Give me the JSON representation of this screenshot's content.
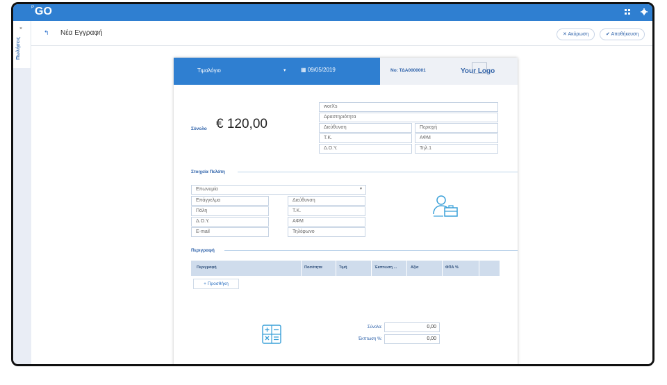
{
  "app": {
    "brand_prefix": "P",
    "brand": "GO"
  },
  "sidebar": {
    "close": "×",
    "label": "Πωλήσεις"
  },
  "header": {
    "back_icon": "↰",
    "title": "Νέα Εγγραφή",
    "cancel": "Ακύρωση",
    "save": "Αποθήκευση"
  },
  "doc": {
    "type": "Τιμολόγιο",
    "date": "09/05/2019",
    "number": "No: ΤΔΑ0000001",
    "logo": "Your Logo",
    "total_label": "Σύνολο",
    "total": "€ 120,00",
    "company": {
      "name": "worXs",
      "activity": "Δραστηριότητα",
      "address": "Διεύθυνση",
      "area": "Περιοχή",
      "zip": "Τ.Κ.",
      "afm": "ΑΦΜ",
      "doy": "Δ.Ο.Υ.",
      "phone": "Τηλ.1"
    },
    "customer_section": "Στοιχεία Πελάτη",
    "customer": {
      "name": "Επωνυμία",
      "profession": "Επάγγελμα",
      "address": "Διεύθυνση",
      "city": "Πόλη",
      "zip": "Τ.Κ.",
      "doy": "Δ.Ο.Υ.",
      "afm": "ΑΦΜ",
      "email": "E-mail",
      "phone": "Τηλέφωνο"
    },
    "desc_section": "Περιγραφή",
    "columns": [
      "Περιγραφή",
      "Ποσότητα",
      "Τιμή",
      "Έκπτωση ...",
      "Αξία",
      "ΦΠΑ %"
    ],
    "add": "+ Προσθήκη",
    "sum_label": "Σύνολο:",
    "sum_value": "0,00",
    "disc_label": "Έκπτωση %:",
    "disc_value": "0,00"
  },
  "colors": {
    "accent": "#2f7fd1",
    "label": "#2a5fa8"
  }
}
